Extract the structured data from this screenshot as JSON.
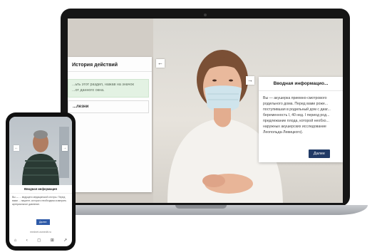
{
  "laptop": {
    "history_panel": {
      "title": "История действий",
      "highlighted_text": "...ьть этот раздел, нажав на значок\n...от данного окна.",
      "item_label": "...лезни",
      "collapse_arrow": "←"
    },
    "intro_panel": {
      "title": "Вводная информацио...",
      "body": "Вы — акушерка приемно-смотрового\nродильного дома. Перед вами роже...\nпоступившая в родильный дом с диаг...\nбеременность I, 40 нед. I период род...\nпредлежание плода, которой необхо...\nнаружных акушерских исследование\nЛеопольда-Левицкого).",
      "next_button": "Далее",
      "expand_arrow": "→"
    }
  },
  "phone": {
    "intro_title": "Вводная информация",
    "intro_body": "Вы — ... ведущего медицинской сестры. Перед вами ... пациент, которого необходимо измерить артериальное давление.",
    "next_button": "Далее",
    "url": "mednet.osmedit.ru",
    "nav_icons": [
      "home-icon",
      "back-icon",
      "tabs-icon",
      "grid-icon",
      "share-icon"
    ]
  },
  "colors": {
    "button_dark": "#213a66",
    "button_phone": "#2e5aa8",
    "history_highlight": "#e3f2e3"
  }
}
